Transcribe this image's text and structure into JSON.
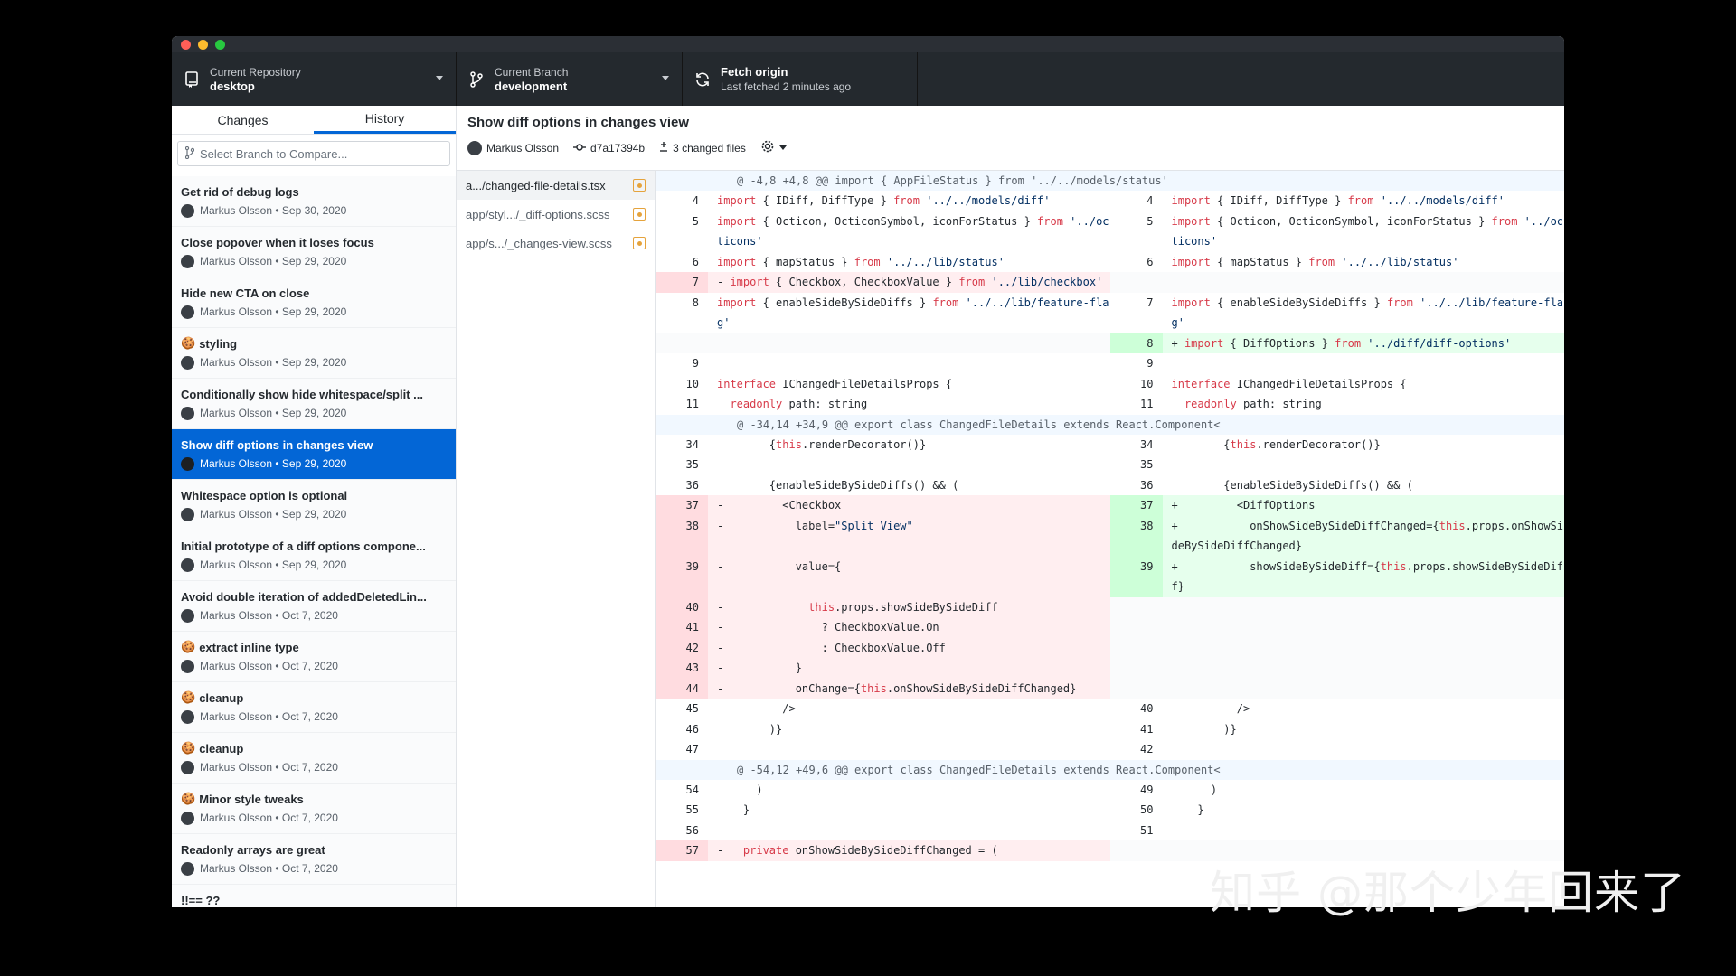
{
  "toolbar": {
    "repo_label": "Current Repository",
    "repo_value": "desktop",
    "branch_label": "Current Branch",
    "branch_value": "development",
    "fetch_label": "Fetch origin",
    "fetch_value": "Last fetched 2 minutes ago"
  },
  "sidebar": {
    "tabs": [
      "Changes",
      "History"
    ],
    "compare_placeholder": "Select Branch to Compare...",
    "commits": [
      {
        "title": "Get rid of debug logs",
        "meta": "Markus Olsson • Sep 30, 2020",
        "emoji": ""
      },
      {
        "title": "Close popover when it loses focus",
        "meta": "Markus Olsson • Sep 29, 2020",
        "emoji": ""
      },
      {
        "title": "Hide new CTA on close",
        "meta": "Markus Olsson • Sep 29, 2020",
        "emoji": ""
      },
      {
        "title": "styling",
        "meta": "Markus Olsson • Sep 29, 2020",
        "emoji": "🍪"
      },
      {
        "title": "Conditionally show hide whitespace/split ...",
        "meta": "Markus Olsson • Sep 29, 2020",
        "emoji": ""
      },
      {
        "title": "Show diff options in changes view",
        "meta": "Markus Olsson • Sep 29, 2020",
        "emoji": "",
        "selected": true
      },
      {
        "title": "Whitespace option is optional",
        "meta": "Markus Olsson • Sep 29, 2020",
        "emoji": ""
      },
      {
        "title": "Initial prototype of a diff options compone...",
        "meta": "Markus Olsson • Sep 29, 2020",
        "emoji": ""
      },
      {
        "title": "Avoid double iteration of addedDeletedLin...",
        "meta": "Markus Olsson • Oct 7, 2020",
        "emoji": ""
      },
      {
        "title": "extract inline type",
        "meta": "Markus Olsson • Oct 7, 2020",
        "emoji": "🍪"
      },
      {
        "title": "cleanup",
        "meta": "Markus Olsson • Oct 7, 2020",
        "emoji": "🍪"
      },
      {
        "title": "cleanup",
        "meta": "Markus Olsson • Oct 7, 2020",
        "emoji": "🍪"
      },
      {
        "title": "Minor style tweaks",
        "meta": "Markus Olsson • Oct 7, 2020",
        "emoji": "🍪"
      },
      {
        "title": "Readonly arrays are great",
        "meta": "Markus Olsson • Oct 7, 2020",
        "emoji": ""
      },
      {
        "title": "!!== ??",
        "meta": "",
        "emoji": ""
      }
    ]
  },
  "commit": {
    "title": "Show diff options in changes view",
    "author": "Markus Olsson",
    "sha": "d7a17394b",
    "changed_files": "3 changed files"
  },
  "files": [
    {
      "name": "a.../changed-file-details.tsx",
      "selected": true
    },
    {
      "name": "app/styl.../_diff-options.scss",
      "selected": false
    },
    {
      "name": "app/s.../_changes-view.scss",
      "selected": false
    }
  ],
  "diff": [
    {
      "type": "hunk",
      "text": "@ -4,8 +4,8 @@ import { AppFileStatus } from '../../models/status'"
    },
    {
      "type": "row",
      "l": {
        "n": "4",
        "c": "import { IDiff, DiffType } from '../../models/diff'"
      },
      "r": {
        "n": "4",
        "c": "import { IDiff, DiffType } from '../../models/diff'"
      }
    },
    {
      "type": "row",
      "l": {
        "n": "5",
        "c": "import { Octicon, OcticonSymbol, iconForStatus } from '../octicons'"
      },
      "r": {
        "n": "5",
        "c": "import { Octicon, OcticonSymbol, iconForStatus } from '../octicons'"
      }
    },
    {
      "type": "row",
      "l": {
        "n": "6",
        "c": "import { mapStatus } from '../../lib/status'"
      },
      "r": {
        "n": "6",
        "c": "import { mapStatus } from '../../lib/status'"
      }
    },
    {
      "type": "row",
      "l": {
        "n": "7",
        "c": "- import { Checkbox, CheckboxValue } from '../lib/checkbox'",
        "k": "del"
      },
      "r": {
        "n": "",
        "c": "",
        "k": "empty"
      }
    },
    {
      "type": "row",
      "l": {
        "n": "8",
        "c": "import { enableSideBySideDiffs } from '../../lib/feature-flag'"
      },
      "r": {
        "n": "7",
        "c": "import { enableSideBySideDiffs } from '../../lib/feature-flag'"
      }
    },
    {
      "type": "row",
      "l": {
        "n": "",
        "c": "",
        "k": "empty"
      },
      "r": {
        "n": "8",
        "c": "+ import { DiffOptions } from '../diff/diff-options'",
        "k": "add"
      }
    },
    {
      "type": "row",
      "l": {
        "n": "9",
        "c": ""
      },
      "r": {
        "n": "9",
        "c": ""
      }
    },
    {
      "type": "row",
      "l": {
        "n": "10",
        "c": "interface IChangedFileDetailsProps {"
      },
      "r": {
        "n": "10",
        "c": "interface IChangedFileDetailsProps {"
      }
    },
    {
      "type": "row",
      "l": {
        "n": "11",
        "c": "  readonly path: string"
      },
      "r": {
        "n": "11",
        "c": "  readonly path: string"
      }
    },
    {
      "type": "hunk",
      "text": "@ -34,14 +34,9 @@ export class ChangedFileDetails extends React.Component<"
    },
    {
      "type": "row",
      "l": {
        "n": "34",
        "c": "        {this.renderDecorator()}"
      },
      "r": {
        "n": "34",
        "c": "        {this.renderDecorator()}"
      }
    },
    {
      "type": "row",
      "l": {
        "n": "35",
        "c": ""
      },
      "r": {
        "n": "35",
        "c": ""
      }
    },
    {
      "type": "row",
      "l": {
        "n": "36",
        "c": "        {enableSideBySideDiffs() && ("
      },
      "r": {
        "n": "36",
        "c": "        {enableSideBySideDiffs() && ("
      }
    },
    {
      "type": "row",
      "l": {
        "n": "37",
        "c": "-         <Checkbox",
        "k": "del"
      },
      "r": {
        "n": "37",
        "c": "+         <DiffOptions",
        "k": "add"
      }
    },
    {
      "type": "row",
      "l": {
        "n": "38",
        "c": "-           label=\"Split View\"",
        "k": "del"
      },
      "r": {
        "n": "38",
        "c": "+           onShowSideBySideDiffChanged={this.props.onShowSideBySideDiffChanged}",
        "k": "add"
      }
    },
    {
      "type": "row",
      "l": {
        "n": "39",
        "c": "-           value={",
        "k": "del"
      },
      "r": {
        "n": "39",
        "c": "+           showSideBySideDiff={this.props.showSideBySideDiff}",
        "k": "add"
      }
    },
    {
      "type": "row",
      "l": {
        "n": "40",
        "c": "-             this.props.showSideBySideDiff",
        "k": "del"
      },
      "r": {
        "n": "",
        "c": "",
        "k": "empty"
      }
    },
    {
      "type": "row",
      "l": {
        "n": "41",
        "c": "-               ? CheckboxValue.On",
        "k": "del"
      },
      "r": {
        "n": "",
        "c": "",
        "k": "empty"
      }
    },
    {
      "type": "row",
      "l": {
        "n": "42",
        "c": "-               : CheckboxValue.Off",
        "k": "del"
      },
      "r": {
        "n": "",
        "c": "",
        "k": "empty"
      }
    },
    {
      "type": "row",
      "l": {
        "n": "43",
        "c": "-           }",
        "k": "del"
      },
      "r": {
        "n": "",
        "c": "",
        "k": "empty"
      }
    },
    {
      "type": "row",
      "l": {
        "n": "44",
        "c": "-           onChange={this.onShowSideBySideDiffChanged}",
        "k": "del"
      },
      "r": {
        "n": "",
        "c": "",
        "k": "empty"
      }
    },
    {
      "type": "row",
      "l": {
        "n": "45",
        "c": "          />"
      },
      "r": {
        "n": "40",
        "c": "          />"
      }
    },
    {
      "type": "row",
      "l": {
        "n": "46",
        "c": "        )}"
      },
      "r": {
        "n": "41",
        "c": "        )}"
      }
    },
    {
      "type": "row",
      "l": {
        "n": "47",
        "c": ""
      },
      "r": {
        "n": "42",
        "c": ""
      }
    },
    {
      "type": "hunk",
      "text": "@ -54,12 +49,6 @@ export class ChangedFileDetails extends React.Component<"
    },
    {
      "type": "row",
      "l": {
        "n": "54",
        "c": "      )"
      },
      "r": {
        "n": "49",
        "c": "      )"
      }
    },
    {
      "type": "row",
      "l": {
        "n": "55",
        "c": "    }"
      },
      "r": {
        "n": "50",
        "c": "    }"
      }
    },
    {
      "type": "row",
      "l": {
        "n": "56",
        "c": ""
      },
      "r": {
        "n": "51",
        "c": ""
      }
    },
    {
      "type": "row",
      "l": {
        "n": "57",
        "c": "-   private onShowSideBySideDiffChanged = (",
        "k": "del"
      },
      "r": {
        "n": "",
        "c": "",
        "k": "empty"
      }
    }
  ],
  "watermark": "知乎 @那个少年回来了",
  "colors": {
    "accent": "#0366d6",
    "toolbar": "#24292e",
    "deletion": "#ffeef0",
    "addition": "#e6ffed"
  },
  "icons": [
    "repo-icon",
    "branch-icon",
    "sync-icon",
    "commit-icon",
    "diff-icon",
    "gear-icon"
  ]
}
